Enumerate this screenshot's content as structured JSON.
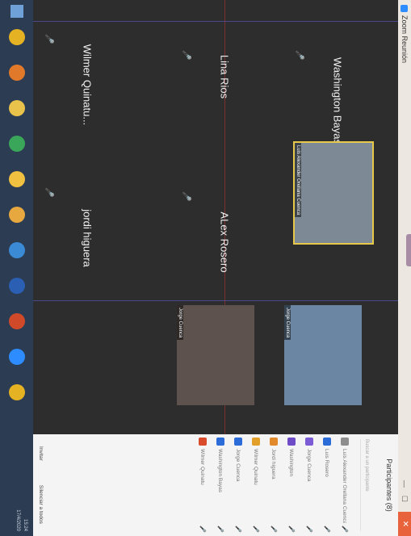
{
  "window": {
    "title": "Zoom Reunión",
    "close_glyph": "✕"
  },
  "tiles": {
    "washington": {
      "name": "Washington Bayas"
    },
    "lina": {
      "name": "Lina Rios"
    },
    "alex": {
      "name": "ALex Rosero"
    },
    "wilmer": {
      "name": "Wilmer Quinatu..."
    },
    "jordi": {
      "name": "jordi higuera"
    },
    "active_video": {
      "caption": "Luis Alexander Orellana Cuenca"
    },
    "video2": {
      "caption": "Jorge Cuenca"
    },
    "video3": {
      "caption": "Jorge Cuenca"
    }
  },
  "participants": {
    "title": "Participantes (8)",
    "search_placeholder": "Buscar a un participante",
    "items": [
      {
        "name": "Luis Alexander Orellana Cuenca",
        "color": "#8e8e8e"
      },
      {
        "name": "Luis Rosero",
        "color": "#2b6cd8"
      },
      {
        "name": "Jorge Cuenca",
        "color": "#7b5cd6"
      },
      {
        "name": "Washington",
        "color": "#6f4cc7"
      },
      {
        "name": "Jordi higuera",
        "color": "#e28a2b"
      },
      {
        "name": "Wilmer Quinatu",
        "color": "#e2a02b"
      },
      {
        "name": "Jorge Cuenca",
        "color": "#2b6cd8"
      },
      {
        "name": "Washington Bayas",
        "color": "#2b6cd8"
      },
      {
        "name": "Wilmer Quinatu",
        "color": "#d94b2b"
      }
    ],
    "footer": {
      "invite": "Invitar",
      "mute_all": "Silenciar a todos"
    }
  },
  "taskbar": {
    "time": "15:24",
    "date": "17/4/2020",
    "icons": [
      {
        "name": "chrome-icon",
        "color": "#e5b224"
      },
      {
        "name": "firefox-icon",
        "color": "#e07a2a"
      },
      {
        "name": "explorer-icon",
        "color": "#e8c24a"
      },
      {
        "name": "app-icon-green",
        "color": "#3aa65a"
      },
      {
        "name": "folder-icon",
        "color": "#f0c040"
      },
      {
        "name": "store-icon",
        "color": "#e8a840"
      },
      {
        "name": "mail-icon",
        "color": "#3a8ad6"
      },
      {
        "name": "word-icon",
        "color": "#2a5fb3"
      },
      {
        "name": "powerpoint-icon",
        "color": "#d04a2a"
      },
      {
        "name": "zoom-icon",
        "color": "#2d8cff"
      },
      {
        "name": "chrome-icon-2",
        "color": "#e5b224"
      }
    ]
  },
  "colors": {
    "accent": "#2d8cff",
    "active_border": "#e6c84a",
    "mic_muted": "#d64545"
  }
}
